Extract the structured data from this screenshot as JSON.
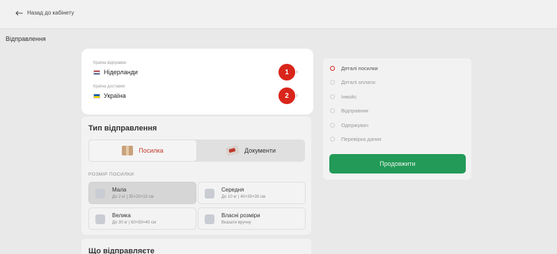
{
  "header": {
    "back_label": "Назад до кабінету"
  },
  "page": {
    "section_title": "Відправлення"
  },
  "country": {
    "from": {
      "label": "Країна відправки",
      "value": "Нідерланди",
      "badge": "1"
    },
    "to": {
      "label": "Країна доставки",
      "value": "Україна",
      "badge": "2"
    }
  },
  "shipment_type": {
    "title": "Тип відправлення",
    "options": [
      {
        "label": "Посилка",
        "icon": "parcel-icon"
      },
      {
        "label": "Документи",
        "icon": "documents-icon"
      }
    ],
    "size_label": "РОЗМІР ПОСИЛКИ",
    "sizes": [
      {
        "name": "Мала",
        "desc": "До 2 кг | 35×20×10 см"
      },
      {
        "name": "Середня",
        "desc": "До 10 кг | 40×30×30 см"
      },
      {
        "name": "Велика",
        "desc": "До 30 кг | 60×50×40 см"
      },
      {
        "name": "Власні розміри",
        "desc": "Вказати вручну"
      }
    ]
  },
  "what_sending": {
    "title": "Що відправляєте"
  },
  "steps": {
    "items": [
      "Деталі посилки",
      "Деталі оплати",
      "Інвойс",
      "Відправник",
      "Одержувач",
      "Перевірка даних"
    ],
    "continue_label": "Продовжити"
  },
  "colors": {
    "accent": "#d9251b",
    "primary_button": "#239a57"
  }
}
